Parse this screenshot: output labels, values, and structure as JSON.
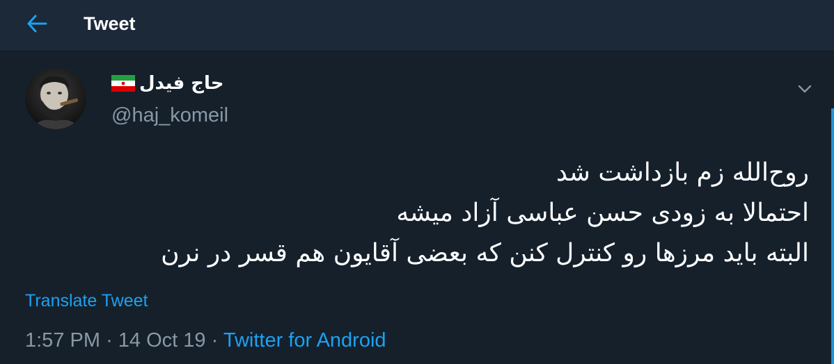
{
  "header": {
    "title": "Tweet",
    "back_icon": "arrow-left-icon",
    "accent_color": "#1da1f2"
  },
  "author": {
    "display_name": "حاج فیدل",
    "flag_icon": "iran-flag-icon",
    "handle": "@haj_komeil",
    "avatar_icon": "avatar-photo"
  },
  "tweet": {
    "lines": [
      "روح‌الله زم بازداشت شد",
      "احتمالا به زودی حسن عباسی آزاد میشه",
      "البته باید مرزها رو کنترل کنن که بعضی آقایون هم قسر در نرن"
    ],
    "translate_label": "Translate Tweet",
    "time": "1:57 PM",
    "separator": "·",
    "date": "14 Oct 19",
    "source": "Twitter for Android"
  },
  "menu_icon": "chevron-down-icon"
}
